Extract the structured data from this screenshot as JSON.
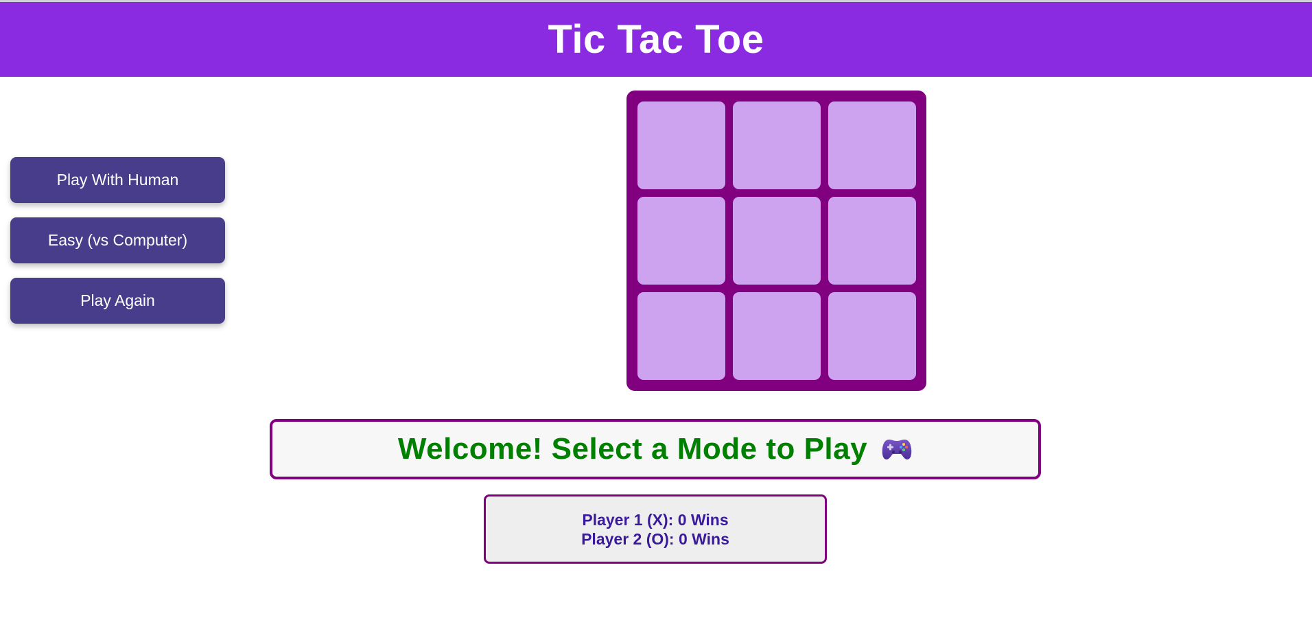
{
  "header": {
    "title": "Tic Tac Toe"
  },
  "sidebar": {
    "buttons": [
      {
        "label": "Play With Human"
      },
      {
        "label": "Easy (vs Computer)"
      },
      {
        "label": "Play Again"
      }
    ]
  },
  "board": {
    "cells": [
      "",
      "",
      "",
      "",
      "",
      "",
      "",
      "",
      ""
    ]
  },
  "message": {
    "text": "Welcome! Select a Mode to Play",
    "icon": "game-controller-icon"
  },
  "scoreboard": {
    "player1": "Player 1 (X): 0 Wins",
    "player2": "Player 2 (O): 0 Wins"
  },
  "colors": {
    "header_bg": "#8a2be2",
    "button_bg": "#483d8b",
    "board_bg": "#800080",
    "cell_bg": "#cda3f0",
    "message_text": "#008000",
    "score_text": "#3a1a9a"
  }
}
